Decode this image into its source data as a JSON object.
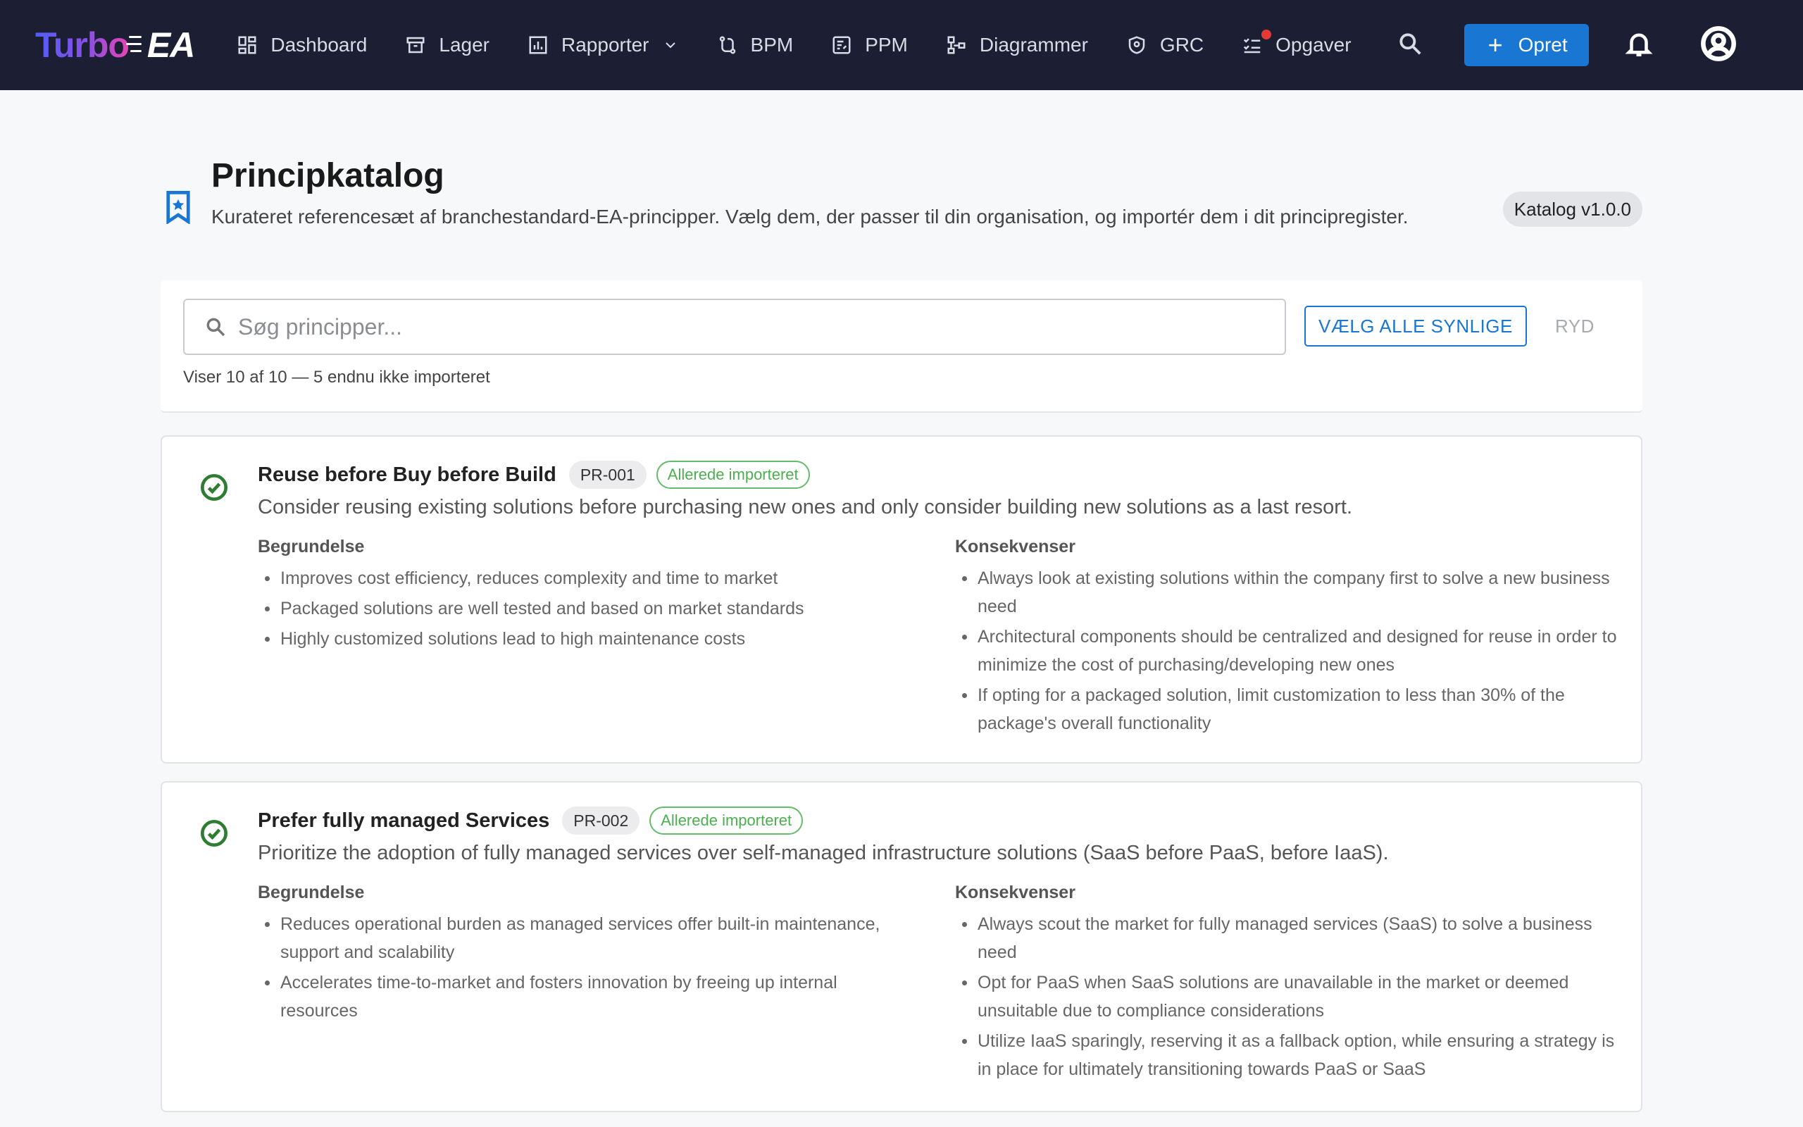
{
  "app": {
    "logo_turbo": "Turbo",
    "logo_ea": "EA"
  },
  "nav": {
    "items": [
      {
        "label": "Dashboard",
        "icon": "dashboard-icon"
      },
      {
        "label": "Lager",
        "icon": "archive-icon"
      },
      {
        "label": "Rapporter",
        "icon": "report-icon",
        "dropdown": true
      },
      {
        "label": "BPM",
        "icon": "bpm-icon"
      },
      {
        "label": "PPM",
        "icon": "ppm-icon"
      },
      {
        "label": "Diagrammer",
        "icon": "diagram-icon"
      },
      {
        "label": "GRC",
        "icon": "shield-icon"
      },
      {
        "label": "Opgaver",
        "icon": "tasks-icon",
        "notification_dot": true
      }
    ],
    "create_label": "Opret"
  },
  "header": {
    "title": "Principkatalog",
    "subtitle": "Kurateret referencesæt af branchestandard-EA-principper. Vælg dem, der passer til din organisation, og importér dem i dit principregister.",
    "version": "Katalog v1.0.0"
  },
  "filter": {
    "search_placeholder": "Søg principper...",
    "search_value": "",
    "select_all_label": "VÆLG ALLE SYNLIGE",
    "clear_label": "RYD",
    "count_text": "Viser 10 af 10 — 5 endnu ikke importeret"
  },
  "principles": [
    {
      "title": "Reuse before Buy before Build",
      "code": "PR-001",
      "status": "Allerede importeret",
      "description": "Consider reusing existing solutions before purchasing new ones and only consider building new solutions as a last resort.",
      "rationale_label": "Begrundelse",
      "rationale": [
        "Improves cost efficiency, reduces complexity and time to market",
        "Packaged solutions are well tested and based on market standards",
        "Highly customized solutions lead to high maintenance costs"
      ],
      "implications_label": "Konsekvenser",
      "implications": [
        "Always look at existing solutions within the company first to solve a new business need",
        "Architectural components should be centralized and designed for reuse in order to minimize the cost of purchasing/developing new ones",
        "If opting for a packaged solution, limit customization to less than 30% of the package's overall functionality"
      ]
    },
    {
      "title": "Prefer fully managed Services",
      "code": "PR-002",
      "status": "Allerede importeret",
      "description": "Prioritize the adoption of fully managed services over self-managed infrastructure solutions (SaaS before PaaS, before IaaS).",
      "rationale_label": "Begrundelse",
      "rationale": [
        "Reduces operational burden as managed services offer built-in maintenance, support and scalability",
        "Accelerates time-to-market and fosters innovation by freeing up internal resources"
      ],
      "implications_label": "Konsekvenser",
      "implications": [
        "Always scout the market for fully managed services (SaaS) to solve a business need",
        "Opt for PaaS when SaaS solutions are unavailable in the market or deemed unsuitable due to compliance considerations",
        "Utilize IaaS sparingly, reserving it as a fallback option, while ensuring a strategy is in place for ultimately transitioning towards PaaS or SaaS"
      ]
    }
  ]
}
